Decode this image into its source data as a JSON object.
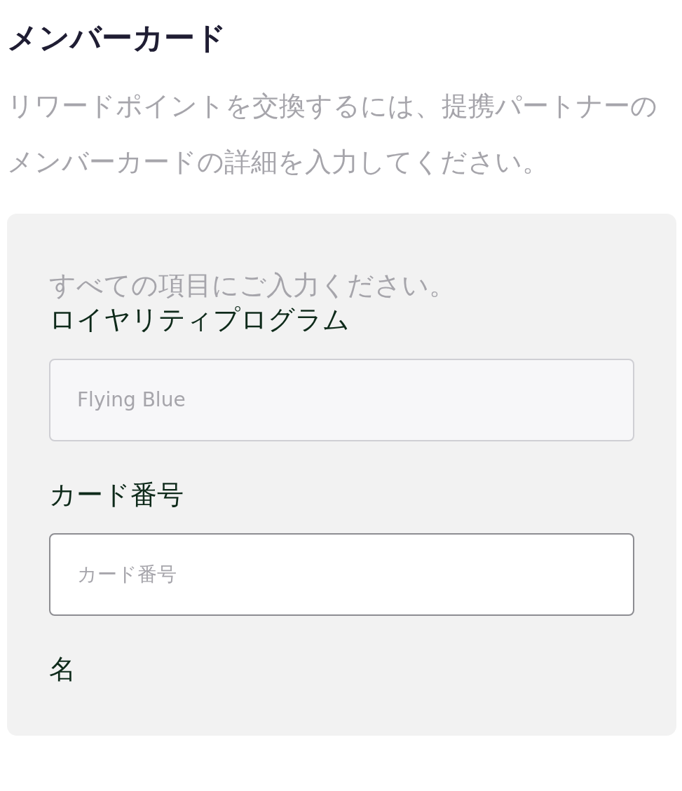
{
  "title": "メンバーカード",
  "description": "リワードポイントを交換するには、提携パートナーのメンバーカードの詳細を入力してください。",
  "form": {
    "hint": "すべての項目にご入力ください。",
    "fields": [
      {
        "label": "ロイヤリティプログラム",
        "value": "Flying Blue",
        "disabled": true
      },
      {
        "label": "カード番号",
        "placeholder": "カード番号",
        "disabled": false
      },
      {
        "label": "名"
      }
    ]
  }
}
